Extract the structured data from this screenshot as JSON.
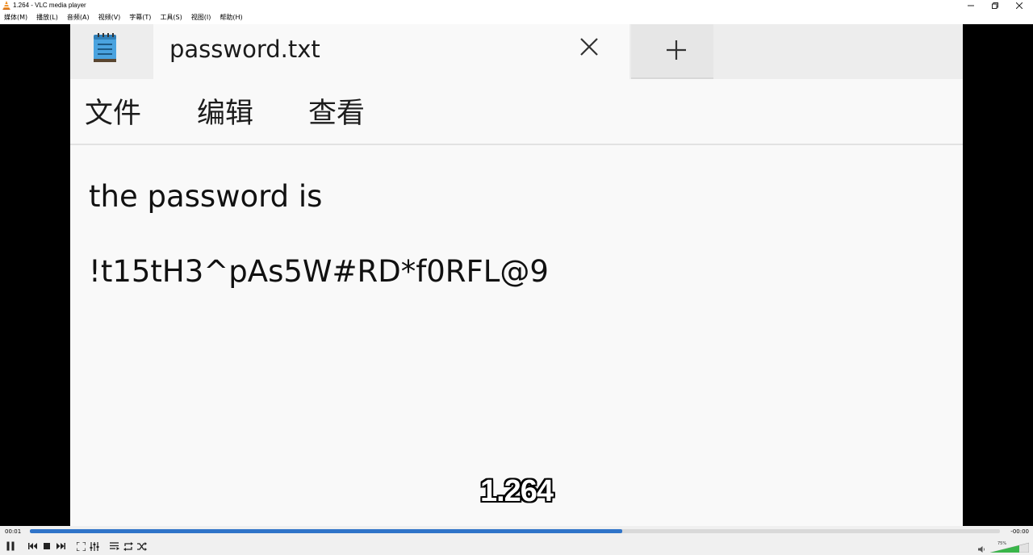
{
  "window": {
    "title": "1.264 - VLC media player",
    "minimize_glyph": "—",
    "restore_glyph": "❐",
    "close_glyph": "✕"
  },
  "menubar": {
    "items": [
      {
        "label": "媒体(M)"
      },
      {
        "label": "播放(L)"
      },
      {
        "label": "音频(A)"
      },
      {
        "label": "视频(V)"
      },
      {
        "label": "字幕(T)"
      },
      {
        "label": "工具(S)"
      },
      {
        "label": "视图(I)"
      },
      {
        "label": "帮助(H)"
      }
    ]
  },
  "video_frame": {
    "tab_title": "password.txt",
    "menu_items": [
      {
        "label": "文件"
      },
      {
        "label": "编辑"
      },
      {
        "label": "查看"
      }
    ],
    "lines": [
      {
        "text": "the password is"
      },
      {
        "text": "!t15tH3^pAs5W#RD*f0RFL@9"
      }
    ],
    "icons": {
      "app": "notepad-icon",
      "close": "close-icon",
      "new_tab": "plus-icon"
    }
  },
  "subtitle": "1.264",
  "playback": {
    "elapsed": "00:01",
    "remaining": "-00:00",
    "progress_fraction": 0.611
  },
  "volume": {
    "label": "75%",
    "level_fraction": 0.75
  },
  "colors": {
    "accent": "#2f74c9",
    "volume_green": "#3ab54a",
    "vlc_orange": "#f08a1c"
  }
}
